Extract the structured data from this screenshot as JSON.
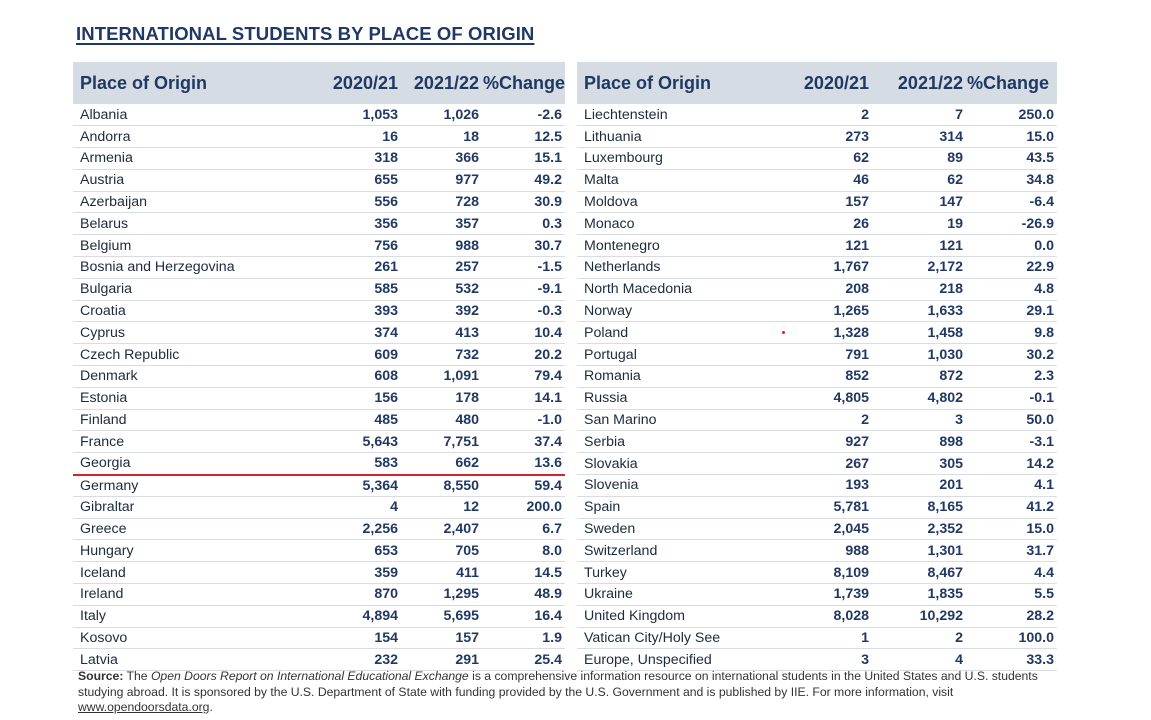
{
  "title": "INTERNATIONAL STUDENTS BY PLACE OF ORIGIN",
  "headers": {
    "place": "Place of Origin",
    "y2021": "2020/21",
    "y2122": "2021/22",
    "change": "%Change"
  },
  "left_rows": [
    {
      "place": "Albania",
      "y2021": "1,053",
      "y2122": "1,026",
      "change": "-2.6"
    },
    {
      "place": "Andorra",
      "y2021": "16",
      "y2122": "18",
      "change": "12.5"
    },
    {
      "place": "Armenia",
      "y2021": "318",
      "y2122": "366",
      "change": "15.1"
    },
    {
      "place": "Austria",
      "y2021": "655",
      "y2122": "977",
      "change": "49.2"
    },
    {
      "place": "Azerbaijan",
      "y2021": "556",
      "y2122": "728",
      "change": "30.9"
    },
    {
      "place": "Belarus",
      "y2021": "356",
      "y2122": "357",
      "change": "0.3"
    },
    {
      "place": "Belgium",
      "y2021": "756",
      "y2122": "988",
      "change": "30.7"
    },
    {
      "place": "Bosnia and Herzegovina",
      "y2021": "261",
      "y2122": "257",
      "change": "-1.5"
    },
    {
      "place": "Bulgaria",
      "y2021": "585",
      "y2122": "532",
      "change": "-9.1"
    },
    {
      "place": "Croatia",
      "y2021": "393",
      "y2122": "392",
      "change": "-0.3"
    },
    {
      "place": "Cyprus",
      "y2021": "374",
      "y2122": "413",
      "change": "10.4"
    },
    {
      "place": "Czech Republic",
      "y2021": "609",
      "y2122": "732",
      "change": "20.2"
    },
    {
      "place": "Denmark",
      "y2021": "608",
      "y2122": "1,091",
      "change": "79.4"
    },
    {
      "place": "Estonia",
      "y2021": "156",
      "y2122": "178",
      "change": "14.1"
    },
    {
      "place": "Finland",
      "y2021": "485",
      "y2122": "480",
      "change": "-1.0"
    },
    {
      "place": "France",
      "y2021": "5,643",
      "y2122": "7,751",
      "change": "37.4"
    },
    {
      "place": "Georgia",
      "y2021": "583",
      "y2122": "662",
      "change": "13.6"
    },
    {
      "place": "Germany",
      "y2021": "5,364",
      "y2122": "8,550",
      "change": "59.4"
    },
    {
      "place": "Gibraltar",
      "y2021": "4",
      "y2122": "12",
      "change": "200.0"
    },
    {
      "place": "Greece",
      "y2021": "2,256",
      "y2122": "2,407",
      "change": "6.7"
    },
    {
      "place": "Hungary",
      "y2021": "653",
      "y2122": "705",
      "change": "8.0"
    },
    {
      "place": "Iceland",
      "y2021": "359",
      "y2122": "411",
      "change": "14.5"
    },
    {
      "place": "Ireland",
      "y2021": "870",
      "y2122": "1,295",
      "change": "48.9"
    },
    {
      "place": "Italy",
      "y2021": "4,894",
      "y2122": "5,695",
      "change": "16.4"
    },
    {
      "place": "Kosovo",
      "y2021": "154",
      "y2122": "157",
      "change": "1.9"
    },
    {
      "place": "Latvia",
      "y2021": "232",
      "y2122": "291",
      "change": "25.4"
    }
  ],
  "right_rows": [
    {
      "place": "Liechtenstein",
      "y2021": "2",
      "y2122": "7",
      "change": "250.0"
    },
    {
      "place": "Lithuania",
      "y2021": "273",
      "y2122": "314",
      "change": "15.0"
    },
    {
      "place": "Luxembourg",
      "y2021": "62",
      "y2122": "89",
      "change": "43.5"
    },
    {
      "place": "Malta",
      "y2021": "46",
      "y2122": "62",
      "change": "34.8"
    },
    {
      "place": "Moldova",
      "y2021": "157",
      "y2122": "147",
      "change": "-6.4"
    },
    {
      "place": "Monaco",
      "y2021": "26",
      "y2122": "19",
      "change": "-26.9"
    },
    {
      "place": "Montenegro",
      "y2021": "121",
      "y2122": "121",
      "change": "0.0"
    },
    {
      "place": "Netherlands",
      "y2021": "1,767",
      "y2122": "2,172",
      "change": "22.9"
    },
    {
      "place": "North Macedonia",
      "y2021": "208",
      "y2122": "218",
      "change": "4.8"
    },
    {
      "place": "Norway",
      "y2021": "1,265",
      "y2122": "1,633",
      "change": "29.1"
    },
    {
      "place": "Poland",
      "y2021": "1,328",
      "y2122": "1,458",
      "change": "9.8"
    },
    {
      "place": "Portugal",
      "y2021": "791",
      "y2122": "1,030",
      "change": "30.2"
    },
    {
      "place": "Romania",
      "y2021": "852",
      "y2122": "872",
      "change": "2.3"
    },
    {
      "place": "Russia",
      "y2021": "4,805",
      "y2122": "4,802",
      "change": "-0.1"
    },
    {
      "place": "San Marino",
      "y2021": "2",
      "y2122": "3",
      "change": "50.0"
    },
    {
      "place": "Serbia",
      "y2021": "927",
      "y2122": "898",
      "change": "-3.1"
    },
    {
      "place": "Slovakia",
      "y2021": "267",
      "y2122": "305",
      "change": "14.2"
    },
    {
      "place": "Slovenia",
      "y2021": "193",
      "y2122": "201",
      "change": "4.1"
    },
    {
      "place": "Spain",
      "y2021": "5,781",
      "y2122": "8,165",
      "change": "41.2"
    },
    {
      "place": "Sweden",
      "y2021": "2,045",
      "y2122": "2,352",
      "change": "15.0"
    },
    {
      "place": "Switzerland",
      "y2021": "988",
      "y2122": "1,301",
      "change": "31.7"
    },
    {
      "place": "Turkey",
      "y2021": "8,109",
      "y2122": "8,467",
      "change": "4.4"
    },
    {
      "place": "Ukraine",
      "y2021": "1,739",
      "y2122": "1,835",
      "change": "5.5"
    },
    {
      "place": "United Kingdom",
      "y2021": "8,028",
      "y2122": "10,292",
      "change": "28.2"
    },
    {
      "place": "Vatican City/Holy See",
      "y2021": "1",
      "y2122": "2",
      "change": "100.0"
    },
    {
      "place": "Europe, Unspecified",
      "y2021": "3",
      "y2122": "4",
      "change": "33.3"
    }
  ],
  "highlighted_place": "Georgia",
  "source": {
    "label": "Source:",
    "text_before": " The ",
    "report_name": "Open Doors Report on International Educational Exchange",
    "text_after": " is a comprehensive information resource on international students in the United States and U.S. students studying abroad. It is sponsored by the U.S. Department of State with funding provided by the U.S. Government and is published by IIE. For more information, visit ",
    "link": "www.opendoorsdata.org",
    "end": "."
  },
  "colors": {
    "title": "#1f3864",
    "header_bg": "#d6dce4",
    "highlight_line": "#d4222f"
  }
}
